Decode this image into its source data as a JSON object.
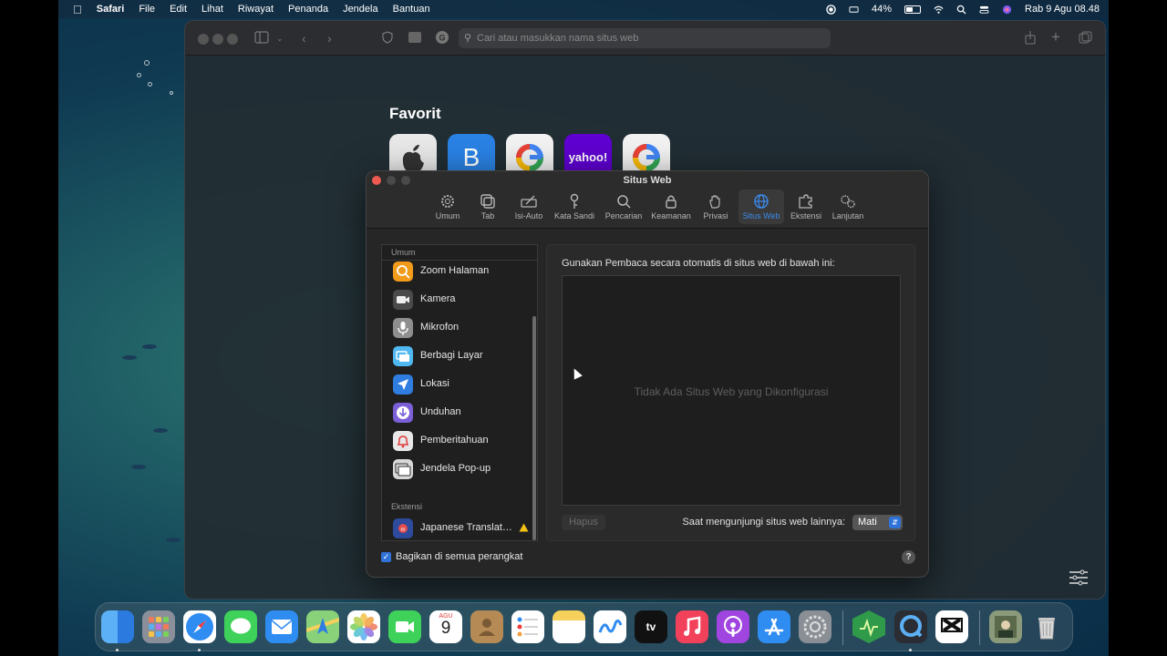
{
  "menubar": {
    "app": "Safari",
    "items": [
      "File",
      "Edit",
      "Lihat",
      "Riwayat",
      "Penanda",
      "Jendela",
      "Bantuan"
    ],
    "battery": "44%",
    "datetime": "Rab 9 Agu  08.48"
  },
  "safari": {
    "url_placeholder": "Cari atau masukkan nama situs web",
    "favorites_title": "Favorit",
    "favorites": [
      {
        "label": "",
        "icon": "apple-icon"
      },
      {
        "label": "B",
        "icon": "bing-icon"
      },
      {
        "label": "",
        "icon": "google-icon"
      },
      {
        "label": "yahoo!",
        "icon": "yahoo-icon"
      },
      {
        "label": "",
        "icon": "google-icon"
      }
    ]
  },
  "prefs": {
    "title": "Situs Web",
    "tabs": [
      {
        "label": "Umum",
        "icon": "gear-icon"
      },
      {
        "label": "Tab",
        "icon": "tabs-icon"
      },
      {
        "label": "Isi-Auto",
        "icon": "autofill-icon"
      },
      {
        "label": "Kata Sandi",
        "icon": "key-icon"
      },
      {
        "label": "Pencarian",
        "icon": "search-icon"
      },
      {
        "label": "Keamanan",
        "icon": "lock-icon"
      },
      {
        "label": "Privasi",
        "icon": "hand-icon"
      },
      {
        "label": "Situs Web",
        "icon": "globe-icon"
      },
      {
        "label": "Ekstensi",
        "icon": "puzzle-icon"
      },
      {
        "label": "Lanjutan",
        "icon": "gears-icon"
      }
    ],
    "active_tab": "Situs Web",
    "sidebar": {
      "section_general": "Umum",
      "items": [
        {
          "label": "Zoom Halaman",
          "icon": "zoom-icon",
          "color": "#f29a1a"
        },
        {
          "label": "Kamera",
          "icon": "camera-icon",
          "color": "#4a4a4a"
        },
        {
          "label": "Mikrofon",
          "icon": "microphone-icon",
          "color": "#8e8e8e"
        },
        {
          "label": "Berbagi Layar",
          "icon": "screen-share-icon",
          "color": "#4fb8f0"
        },
        {
          "label": "Lokasi",
          "icon": "location-icon",
          "color": "#2f7de0"
        },
        {
          "label": "Unduhan",
          "icon": "download-icon",
          "color": "#7b5fd6"
        },
        {
          "label": "Pemberitahuan",
          "icon": "bell-icon",
          "color": "#e8e8e8"
        },
        {
          "label": "Jendela Pop-up",
          "icon": "popup-icon",
          "color": "#d8d8d8"
        }
      ],
      "section_extensions": "Ekstensi",
      "extension_item": "Japanese Translat…"
    },
    "pane": {
      "label": "Gunakan Pembaca secara otomatis di situs web di bawah ini:",
      "empty_message": "Tidak Ada Situs Web yang Dikonfigurasi",
      "remove_button": "Hapus",
      "other_sites_label": "Saat mengunjungi situs web lainnya:",
      "other_sites_value": "Mati"
    },
    "share_label": "Bagikan di semua perangkat",
    "help": "?"
  },
  "dock": {
    "calendar_month": "AGU",
    "calendar_day": "9",
    "tv_label": "tv"
  }
}
